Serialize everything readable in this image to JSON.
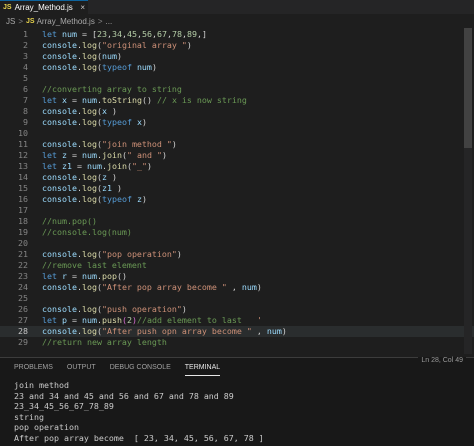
{
  "tab": {
    "badge": "JS",
    "filename": "Array_Method.js",
    "close": "×"
  },
  "breadcrumb": {
    "folder": "JS",
    "separator": ">",
    "badge": "JS",
    "file": "Array_Method.js",
    "more": "..."
  },
  "editor": {
    "active_line": 28
  },
  "panel": {
    "tabs": [
      "PROBLEMS",
      "OUTPUT",
      "DEBUG CONSOLE",
      "TERMINAL"
    ],
    "selected_tab": "TERMINAL",
    "terminal_lines": [
      "join method",
      "23 and 34 and 45 and 56 and 67 and 78 and 89",
      "23_34_45_56_67_78_89",
      "string",
      "pop operation",
      "After pop array become  [ 23, 34, 45, 56, 67, 78 ]"
    ],
    "status_fragment": "Ln 28, Col 49"
  },
  "code_lines": [
    {
      "n": "1",
      "seg": [
        [
          "kw",
          "let "
        ],
        [
          "var",
          "num"
        ],
        [
          "pn",
          " = ["
        ],
        [
          "num",
          "23"
        ],
        [
          "pn",
          ","
        ],
        [
          "num",
          "34"
        ],
        [
          "pn",
          ","
        ],
        [
          "num",
          "45"
        ],
        [
          "pn",
          ","
        ],
        [
          "num",
          "56"
        ],
        [
          "pn",
          ","
        ],
        [
          "num",
          "67"
        ],
        [
          "pn",
          ","
        ],
        [
          "num",
          "78"
        ],
        [
          "pn",
          ","
        ],
        [
          "num",
          "89"
        ],
        [
          "pn",
          ",]"
        ]
      ]
    },
    {
      "n": "2",
      "seg": [
        [
          "var",
          "console"
        ],
        [
          "pn",
          "."
        ],
        [
          "fn",
          "log"
        ],
        [
          "pn",
          "("
        ],
        [
          "str",
          "\"original array \""
        ],
        [
          "pn",
          ")"
        ]
      ]
    },
    {
      "n": "3",
      "seg": [
        [
          "var",
          "console"
        ],
        [
          "pn",
          "."
        ],
        [
          "fn",
          "log"
        ],
        [
          "pn",
          "("
        ],
        [
          "var",
          "num"
        ],
        [
          "pn",
          ")"
        ]
      ]
    },
    {
      "n": "4",
      "seg": [
        [
          "var",
          "console"
        ],
        [
          "pn",
          "."
        ],
        [
          "fn",
          "log"
        ],
        [
          "pn",
          "("
        ],
        [
          "kw",
          "typeof "
        ],
        [
          "var",
          "num"
        ],
        [
          "pn",
          ")"
        ]
      ]
    },
    {
      "n": "5",
      "seg": []
    },
    {
      "n": "6",
      "seg": [
        [
          "com",
          "//converting array to string"
        ]
      ]
    },
    {
      "n": "7",
      "seg": [
        [
          "kw",
          "let "
        ],
        [
          "var",
          "x"
        ],
        [
          "pn",
          " = "
        ],
        [
          "var",
          "num"
        ],
        [
          "pn",
          "."
        ],
        [
          "fn",
          "toString"
        ],
        [
          "pn",
          "() "
        ],
        [
          "com",
          "// x is now string"
        ]
      ]
    },
    {
      "n": "8",
      "seg": [
        [
          "var",
          "console"
        ],
        [
          "pn",
          "."
        ],
        [
          "fn",
          "log"
        ],
        [
          "pn",
          "("
        ],
        [
          "var",
          "x "
        ],
        [
          "pn",
          ")"
        ]
      ]
    },
    {
      "n": "9",
      "seg": [
        [
          "var",
          "console"
        ],
        [
          "pn",
          "."
        ],
        [
          "fn",
          "log"
        ],
        [
          "pn",
          "("
        ],
        [
          "kw",
          "typeof "
        ],
        [
          "var",
          "x"
        ],
        [
          "pn",
          ")"
        ]
      ]
    },
    {
      "n": "10",
      "seg": []
    },
    {
      "n": "11",
      "seg": [
        [
          "var",
          "console"
        ],
        [
          "pn",
          "."
        ],
        [
          "fn",
          "log"
        ],
        [
          "pn",
          "("
        ],
        [
          "str",
          "\"join method \""
        ],
        [
          "pn",
          ")"
        ]
      ]
    },
    {
      "n": "12",
      "seg": [
        [
          "kw",
          "let "
        ],
        [
          "var",
          "z"
        ],
        [
          "pn",
          " = "
        ],
        [
          "var",
          "num"
        ],
        [
          "pn",
          "."
        ],
        [
          "fn",
          "join"
        ],
        [
          "pn",
          "("
        ],
        [
          "str",
          "\" and \""
        ],
        [
          "pn",
          ")"
        ]
      ]
    },
    {
      "n": "13",
      "seg": [
        [
          "kw",
          "let "
        ],
        [
          "var",
          "z1"
        ],
        [
          "pn",
          " = "
        ],
        [
          "var",
          "num"
        ],
        [
          "pn",
          "."
        ],
        [
          "fn",
          "join"
        ],
        [
          "pn",
          "("
        ],
        [
          "str",
          "\"_\""
        ],
        [
          "pn",
          ")"
        ]
      ]
    },
    {
      "n": "14",
      "seg": [
        [
          "var",
          "console"
        ],
        [
          "pn",
          "."
        ],
        [
          "fn",
          "log"
        ],
        [
          "pn",
          "("
        ],
        [
          "var",
          "z "
        ],
        [
          "pn",
          ")"
        ]
      ]
    },
    {
      "n": "15",
      "seg": [
        [
          "var",
          "console"
        ],
        [
          "pn",
          "."
        ],
        [
          "fn",
          "log"
        ],
        [
          "pn",
          "("
        ],
        [
          "var",
          "z1 "
        ],
        [
          "pn",
          ")"
        ]
      ]
    },
    {
      "n": "16",
      "seg": [
        [
          "var",
          "console"
        ],
        [
          "pn",
          "."
        ],
        [
          "fn",
          "log"
        ],
        [
          "pn",
          "("
        ],
        [
          "kw",
          "typeof "
        ],
        [
          "var",
          "z"
        ],
        [
          "pn",
          ")"
        ]
      ]
    },
    {
      "n": "17",
      "seg": []
    },
    {
      "n": "18",
      "seg": [
        [
          "com",
          "//num.pop()"
        ]
      ]
    },
    {
      "n": "19",
      "seg": [
        [
          "com",
          "//console.log(num)"
        ]
      ]
    },
    {
      "n": "20",
      "seg": []
    },
    {
      "n": "21",
      "seg": [
        [
          "var",
          "console"
        ],
        [
          "pn",
          "."
        ],
        [
          "fn",
          "log"
        ],
        [
          "pn",
          "("
        ],
        [
          "str",
          "\"pop operation\""
        ],
        [
          "pn",
          ")"
        ]
      ]
    },
    {
      "n": "22",
      "seg": [
        [
          "com",
          "//remove last element"
        ]
      ]
    },
    {
      "n": "23",
      "seg": [
        [
          "kw",
          "let "
        ],
        [
          "var",
          "r"
        ],
        [
          "pn",
          " = "
        ],
        [
          "var",
          "num"
        ],
        [
          "pn",
          "."
        ],
        [
          "fn",
          "pop"
        ],
        [
          "pn",
          "()"
        ]
      ]
    },
    {
      "n": "24",
      "seg": [
        [
          "var",
          "console"
        ],
        [
          "pn",
          "."
        ],
        [
          "fn",
          "log"
        ],
        [
          "pn",
          "("
        ],
        [
          "str",
          "\"After pop array become \""
        ],
        [
          "pn",
          " , "
        ],
        [
          "var",
          "num"
        ],
        [
          "pn",
          ")"
        ]
      ]
    },
    {
      "n": "25",
      "seg": []
    },
    {
      "n": "26",
      "seg": [
        [
          "var",
          "console"
        ],
        [
          "pn",
          "."
        ],
        [
          "fn",
          "log"
        ],
        [
          "pn",
          "("
        ],
        [
          "str",
          "\"push operation\""
        ],
        [
          "pn",
          ")"
        ]
      ]
    },
    {
      "n": "27",
      "seg": [
        [
          "kw",
          "let "
        ],
        [
          "var",
          "p"
        ],
        [
          "pn",
          " = "
        ],
        [
          "var",
          "num"
        ],
        [
          "pn",
          "."
        ],
        [
          "fn",
          "push"
        ],
        [
          "br",
          "("
        ],
        [
          "num",
          "2"
        ],
        [
          "br",
          ")"
        ],
        [
          "com",
          "//add element to last"
        ],
        [
          "str",
          "   '"
        ]
      ]
    },
    {
      "n": "28",
      "seg": [
        [
          "var",
          "console"
        ],
        [
          "pn",
          "."
        ],
        [
          "fn",
          "log"
        ],
        [
          "pn",
          "("
        ],
        [
          "str",
          "\"After push opn array become \""
        ],
        [
          "pn",
          " , "
        ],
        [
          "var",
          "num"
        ],
        [
          "pn",
          ")"
        ]
      ]
    },
    {
      "n": "29",
      "seg": [
        [
          "com",
          "//return new array length"
        ]
      ]
    }
  ]
}
